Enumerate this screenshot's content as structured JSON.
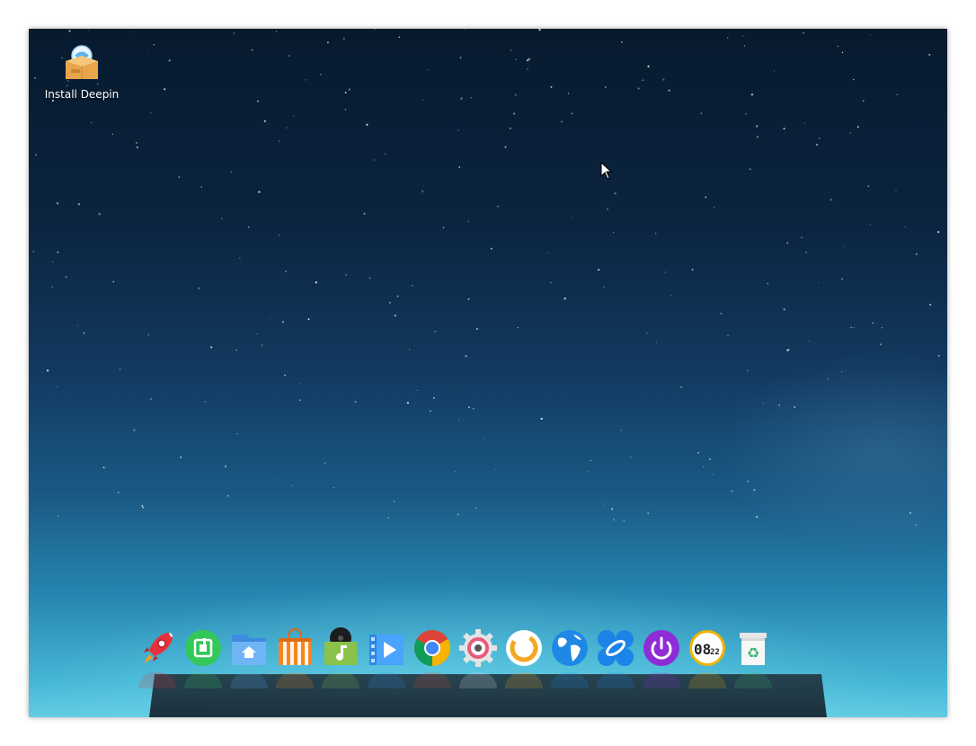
{
  "desktop": {
    "icons": [
      {
        "label": "Install Deepin",
        "icon": "install-package-icon"
      }
    ]
  },
  "dock": {
    "items": [
      {
        "icon": "launcher-rocket-icon",
        "color": "#e8303a"
      },
      {
        "icon": "deepin-store-green-icon",
        "color": "#34c759"
      },
      {
        "icon": "file-manager-icon",
        "color": "#5aa7f0"
      },
      {
        "icon": "app-store-shopping-bag-icon",
        "color": "#f5861f"
      },
      {
        "icon": "music-player-icon",
        "color": "#8bc34a"
      },
      {
        "icon": "movie-player-icon",
        "color": "#2f86e6"
      },
      {
        "icon": "chrome-browser-icon",
        "color": "#db4437"
      },
      {
        "icon": "control-center-gear-icon",
        "color": "#e8e8e8"
      },
      {
        "icon": "system-monitor-ring-icon",
        "color": "#f5a623"
      },
      {
        "icon": "web-browser-globe-icon",
        "color": "#1e88e5"
      },
      {
        "icon": "remote-assistance-icon",
        "color": "#1a84e8"
      },
      {
        "icon": "power-shutdown-icon",
        "color": "#8e2cd8"
      },
      {
        "icon": "clock-icon",
        "color": "#f0b400"
      },
      {
        "icon": "trash-recycle-icon",
        "color": "#3cb371"
      }
    ],
    "clock_hour": "08",
    "clock_minute": "22"
  }
}
